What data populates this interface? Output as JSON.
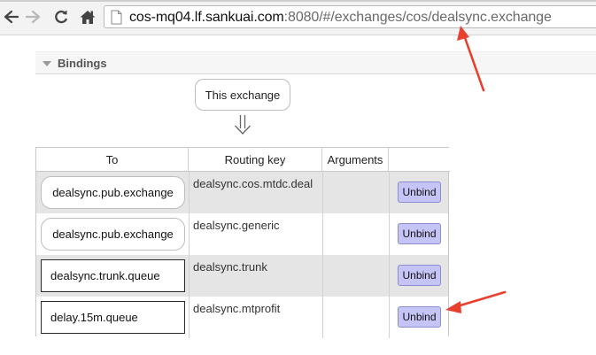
{
  "browser": {
    "url_host": "cos-mq04.lf.sankuai.com",
    "url_rest": ":8080/#/exchanges/cos/dealsync.exchange",
    "back_icon": "back-arrow-icon",
    "forward_icon": "forward-arrow-icon",
    "reload_icon": "reload-icon",
    "home_icon": "home-icon",
    "page_icon": "page-icon"
  },
  "section": {
    "title": "Bindings"
  },
  "source_exchange": {
    "label": "This exchange",
    "arrow_icon": "double-down-arrow-icon"
  },
  "table": {
    "headers": {
      "to": "To",
      "routing_key": "Routing key",
      "arguments": "Arguments",
      "actions": ""
    },
    "rows": [
      {
        "to": "dealsync.pub.exchange",
        "dest_type": "exchange",
        "routing_key": "dealsync.cos.mtdc.deal",
        "arguments": "",
        "action": "Unbind"
      },
      {
        "to": "dealsync.pub.exchange",
        "dest_type": "exchange",
        "routing_key": "dealsync.generic",
        "arguments": "",
        "action": "Unbind"
      },
      {
        "to": "dealsync.trunk.queue",
        "dest_type": "queue",
        "routing_key": "dealsync.trunk",
        "arguments": "",
        "action": "Unbind"
      },
      {
        "to": "delay.15m.queue",
        "dest_type": "queue",
        "routing_key": "dealsync.mtprofit",
        "arguments": "",
        "action": "Unbind"
      }
    ]
  },
  "colors": {
    "annotation_arrow": "#e8402f",
    "unbind_button": "#c5c4f7",
    "row_shade": "#e5e5e5"
  }
}
